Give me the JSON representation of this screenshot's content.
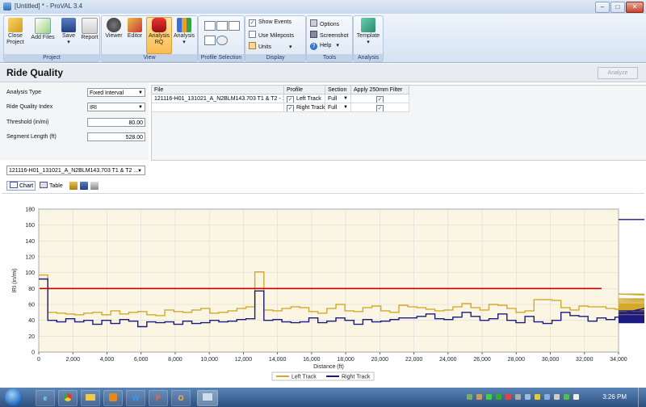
{
  "window": {
    "title": "[Untitled] * - ProVAL 3.4",
    "buttons": {
      "minimize": "‒",
      "maximize": "□",
      "close": "✕"
    }
  },
  "ribbon": {
    "groups": [
      {
        "label": "Project",
        "buttons": [
          "Close Project",
          "Add Files",
          "Save",
          "Report"
        ]
      },
      {
        "label": "View",
        "buttons": [
          "Viewer",
          "Editor",
          "Analysis RQ",
          "Analysis"
        ]
      },
      {
        "label": "Profile Selection"
      },
      {
        "label": "Display",
        "items": [
          "Show Events",
          "Use Mileposts",
          "Units"
        ]
      },
      {
        "label": "Tools",
        "items": [
          "Options",
          "Screenshot",
          "Help"
        ]
      },
      {
        "label": "Analysis",
        "buttons": [
          "Template"
        ]
      }
    ],
    "close_label": "Close",
    "project_label": "Project",
    "add_files_label": "Add Files",
    "save_label": "Save",
    "report_label": "Report",
    "viewer_label": "Viewer",
    "editor_label": "Editor",
    "analysis_rq_line1": "Analysis",
    "analysis_rq_line2": "RQ",
    "analysis_label": "Analysis",
    "show_events": "Show Events",
    "use_mileposts": "Use Mileposts",
    "units": "Units",
    "options": "Options",
    "screenshot": "Screenshot",
    "help": "Help",
    "template": "Template",
    "dropdown_caret": "▾"
  },
  "header": {
    "title": "Ride Quality",
    "analyze_button": "Analyze"
  },
  "settings": {
    "analysis_type_label": "Analysis Type",
    "analysis_type_value": "Fixed Interval",
    "rqi_label": "Ride Quality Index",
    "rqi_value": "IRI",
    "threshold_label": "Threshold (in/mi)",
    "threshold_value": "80.00",
    "segment_label": "Segment Length (ft)",
    "segment_value": "528.00"
  },
  "file_table": {
    "headers": [
      "File",
      "Profile",
      "Section",
      "Apply 250mm Filter"
    ],
    "rows": [
      {
        "file": "121116-H01_131021_A_N2BLM143.703 T1 & T2 - 1",
        "profile": "Left Track",
        "section": "Full",
        "filter": true
      },
      {
        "file": "",
        "profile": "Right Track",
        "section": "Full",
        "filter": true
      }
    ]
  },
  "file_selector": "121116-H01_131021_A_N2BLM143.703 T1 & T2 ...",
  "chart_toolbar": {
    "chart_tab": "Chart",
    "table_tab": "Table"
  },
  "chart_data": {
    "type": "line",
    "xlabel": "Distance (ft)",
    "ylabel": "IRI (in/mi)",
    "xlim": [
      0,
      34000
    ],
    "ylim": [
      0,
      180
    ],
    "xticks": [
      0,
      2000,
      4000,
      6000,
      8000,
      10000,
      12000,
      14000,
      16000,
      18000,
      20000,
      22000,
      24000,
      26000,
      28000,
      30000,
      32000,
      34000
    ],
    "xtick_labels": [
      "0",
      "2,000",
      "4,000",
      "6,000",
      "8,000",
      "10,000",
      "12,000",
      "14,000",
      "16,000",
      "18,000",
      "20,000",
      "22,000",
      "24,000",
      "26,000",
      "28,000",
      "30,000",
      "32,000",
      "34,000"
    ],
    "yticks": [
      0,
      20,
      40,
      60,
      80,
      100,
      120,
      140,
      160,
      180
    ],
    "threshold": 80,
    "grid": true,
    "legend_position": "bottom",
    "step_length": 528,
    "series": [
      {
        "name": "Left Track",
        "color": "#d4a82a",
        "values": [
          97,
          50,
          49,
          48,
          47,
          49,
          50,
          47,
          52,
          48,
          50,
          51,
          47,
          46,
          53,
          51,
          50,
          53,
          55,
          49,
          50,
          52,
          55,
          57,
          101,
          53,
          52,
          55,
          57,
          56,
          51,
          49,
          55,
          60,
          52,
          51,
          56,
          58,
          52,
          50,
          59,
          57,
          56,
          54,
          52,
          53,
          57,
          61,
          56,
          53,
          60,
          59,
          55,
          50,
          52,
          66,
          66,
          65,
          56,
          53,
          58,
          57,
          57,
          55,
          54,
          57,
          58,
          54,
          55,
          51,
          55,
          56,
          60,
          59,
          54,
          54,
          58,
          59,
          58,
          53,
          56,
          51,
          57,
          53,
          55,
          54,
          53,
          48,
          48,
          47,
          49,
          51,
          57,
          57,
          63,
          67,
          65,
          73,
          60,
          51,
          57,
          58,
          58,
          60,
          57,
          61,
          58,
          55,
          58,
          54,
          52,
          56,
          52,
          53
        ]
      },
      {
        "name": "Right Track",
        "color": "#1a1a80",
        "values": [
          92,
          40,
          38,
          42,
          38,
          40,
          35,
          40,
          36,
          41,
          39,
          32,
          38,
          37,
          38,
          35,
          39,
          36,
          37,
          40,
          38,
          39,
          41,
          42,
          77,
          40,
          41,
          38,
          37,
          38,
          43,
          37,
          39,
          43,
          40,
          35,
          41,
          38,
          39,
          41,
          43,
          43,
          45,
          48,
          42,
          41,
          44,
          50,
          45,
          40,
          42,
          48,
          40,
          37,
          45,
          38,
          36,
          40,
          50,
          46,
          45,
          39,
          43,
          41,
          44,
          41,
          42,
          45,
          46,
          40,
          38,
          42,
          40,
          39,
          44,
          37,
          43,
          40,
          43,
          41,
          38,
          39,
          41,
          40,
          39,
          38,
          43,
          42,
          40,
          42,
          43,
          50,
          41,
          40,
          48,
          52,
          50,
          38,
          41,
          43,
          44,
          44,
          45,
          44,
          46,
          45,
          44,
          43,
          44,
          44,
          43,
          46,
          48,
          167
        ]
      }
    ]
  },
  "taskbar": {
    "clock": "3:26 PM",
    "apps": [
      "IE",
      "Chrome",
      "Explorer",
      "Media",
      "Word",
      "PowerPoint",
      "Outlook",
      "Paint"
    ]
  }
}
